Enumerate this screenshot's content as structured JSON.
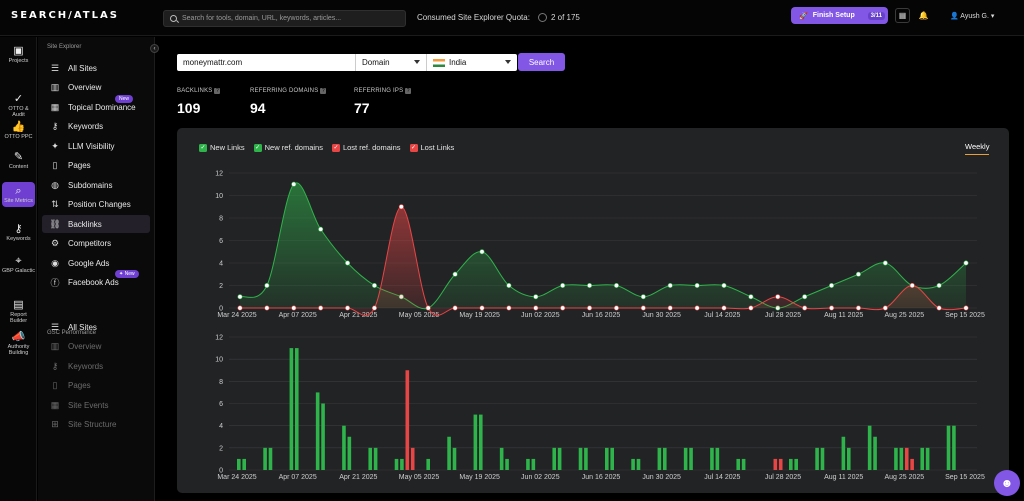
{
  "app": {
    "logo": "SEARCH/ATLAS"
  },
  "header": {
    "search_placeholder": "Search for tools, domain, URL, keywords, articles...",
    "quota_label": "Consumed Site Explorer Quota:",
    "quota_value": "2 of 175",
    "finish_label": "Finish Setup",
    "finish_badge": "3/11",
    "user_name": "Ayush G."
  },
  "rail": [
    {
      "label": "Projects",
      "icon": "briefcase-icon",
      "glyph": "▣"
    },
    {
      "label": "OTTO & Audit",
      "icon": "checklist-icon",
      "glyph": "✓"
    },
    {
      "label": "OTTO PPC",
      "icon": "thumbs-up-icon",
      "glyph": "👍"
    },
    {
      "label": "Content",
      "icon": "pen-icon",
      "glyph": "✎"
    },
    {
      "label": "Site Metrics",
      "icon": "magnifier-chart-icon",
      "glyph": "⌕"
    },
    {
      "label": "Keywords",
      "icon": "key-icon",
      "glyph": "⚷"
    },
    {
      "label": "GBP Galactic",
      "icon": "map-pin-icon",
      "glyph": "⌖"
    },
    {
      "label": "Report Builder",
      "icon": "report-icon",
      "glyph": "▤"
    },
    {
      "label": "Authority Building",
      "icon": "megaphone-icon",
      "glyph": "📣"
    }
  ],
  "sidebar": {
    "section1": "Site Explorer",
    "items1": [
      {
        "label": "All Sites",
        "icon": "list-icon",
        "glyph": "☰"
      },
      {
        "label": "Overview",
        "icon": "overview-icon",
        "glyph": "▥"
      },
      {
        "label": "Topical Dominance",
        "icon": "topical-icon",
        "glyph": "▦"
      },
      {
        "label": "Keywords",
        "icon": "key-icon",
        "glyph": "⚷"
      },
      {
        "label": "LLM Visibility",
        "icon": "sparkle-icon",
        "glyph": "✦"
      },
      {
        "label": "Pages",
        "icon": "page-icon",
        "glyph": "▯"
      },
      {
        "label": "Subdomains",
        "icon": "globe-icon",
        "glyph": "◍"
      },
      {
        "label": "Position Changes",
        "icon": "sort-icon",
        "glyph": "⇅"
      },
      {
        "label": "Backlinks",
        "icon": "link-icon",
        "glyph": "⛓"
      },
      {
        "label": "Competitors",
        "icon": "competitors-icon",
        "glyph": "⚙"
      },
      {
        "label": "Google Ads",
        "icon": "megaphone-icon",
        "glyph": "◉"
      },
      {
        "label": "Facebook Ads",
        "icon": "facebook-icon",
        "glyph": "ⓕ"
      }
    ],
    "new_badge_1": "New",
    "new_badge_2": "✦ New",
    "section2": "GSC Performance",
    "items2": [
      {
        "label": "All Sites",
        "icon": "list-icon",
        "glyph": "☰"
      },
      {
        "label": "Overview",
        "icon": "overview-icon",
        "glyph": "▥"
      },
      {
        "label": "Keywords",
        "icon": "key-icon",
        "glyph": "⚷"
      },
      {
        "label": "Pages",
        "icon": "page-icon",
        "glyph": "▯"
      },
      {
        "label": "Site Events",
        "icon": "calendar-icon",
        "glyph": "▦"
      },
      {
        "label": "Site Structure",
        "icon": "structure-icon",
        "glyph": "⊞"
      }
    ]
  },
  "controls": {
    "domain_value": "moneymattr.com",
    "scope_value": "Domain",
    "country_value": "India",
    "search_label": "Search"
  },
  "stats": [
    {
      "label": "BACKLINKS",
      "value": "109"
    },
    {
      "label": "REFERRING DOMAINS",
      "value": "94"
    },
    {
      "label": "REFERRING IPS",
      "value": "77"
    }
  ],
  "legend": [
    {
      "label": "New Links",
      "color": "#2fb34b"
    },
    {
      "label": "New ref. domains",
      "color": "#2fb34b"
    },
    {
      "label": "Lost ref. domains",
      "color": "#e84545"
    },
    {
      "label": "Lost Links",
      "color": "#e84545"
    }
  ],
  "period_label": "Weekly",
  "colors": {
    "green": "#2fb34b",
    "red": "#e84545",
    "accent": "#8257e5"
  },
  "chart_data": [
    {
      "type": "area",
      "x_ticks": [
        "Mar 24 2025",
        "Apr 07 2025",
        "Apr 21 2025",
        "May 05 2025",
        "May 19 2025",
        "Jun 02 2025",
        "Jun 16 2025",
        "Jun 30 2025",
        "Jul 14 2025",
        "Jul 28 2025",
        "Aug 11 2025",
        "Aug 25 2025",
        "Sep 15 2025"
      ],
      "ylim": [
        0,
        12
      ],
      "y_ticks": [
        0,
        2,
        4,
        6,
        8,
        10,
        12
      ],
      "series": [
        {
          "name": "New ref. domains",
          "color": "#2fb34b",
          "values": [
            1,
            2,
            11,
            7,
            4,
            2,
            1,
            0,
            3,
            5,
            2,
            1,
            2,
            2,
            2,
            1,
            2,
            2,
            2,
            1,
            0,
            1,
            2,
            3,
            4,
            2,
            2,
            4
          ]
        },
        {
          "name": "Lost ref. domains",
          "color": "#e84545",
          "values": [
            0,
            0,
            0,
            0,
            0,
            0,
            9,
            0,
            0,
            0,
            0,
            0,
            0,
            0,
            0,
            0,
            0,
            0,
            0,
            0,
            1,
            0,
            0,
            0,
            0,
            2,
            0,
            0
          ]
        }
      ]
    },
    {
      "type": "bar",
      "x_ticks": [
        "Mar 24 2025",
        "Apr 07 2025",
        "Apr 21 2025",
        "May 05 2025",
        "May 19 2025",
        "Jun 02 2025",
        "Jun 16 2025",
        "Jun 30 2025",
        "Jul 14 2025",
        "Jul 28 2025",
        "Aug 11 2025",
        "Aug 25 2025",
        "Sep 15 2025"
      ],
      "ylim": [
        0,
        12
      ],
      "y_ticks": [
        0,
        2,
        4,
        6,
        8,
        10,
        12
      ],
      "series": [
        {
          "name": "New Links",
          "color": "#2fb34b",
          "values": [
            1,
            2,
            11,
            7,
            4,
            2,
            1,
            0,
            3,
            5,
            2,
            1,
            2,
            2,
            2,
            1,
            2,
            2,
            2,
            1,
            0,
            1,
            2,
            3,
            4,
            2,
            2,
            4
          ]
        },
        {
          "name": "New ref. domains",
          "color": "#2fb34b",
          "values": [
            1,
            2,
            11,
            6,
            3,
            2,
            1,
            1,
            2,
            5,
            1,
            1,
            2,
            2,
            2,
            1,
            2,
            2,
            2,
            1,
            0,
            1,
            2,
            2,
            3,
            2,
            2,
            4
          ]
        },
        {
          "name": "Lost ref. domains",
          "color": "#e84545",
          "values": [
            0,
            0,
            0,
            0,
            0,
            0,
            9,
            0,
            0,
            0,
            0,
            0,
            0,
            0,
            0,
            0,
            0,
            0,
            0,
            0,
            1,
            0,
            0,
            0,
            0,
            2,
            0,
            0
          ]
        },
        {
          "name": "Lost Links",
          "color": "#e84545",
          "values": [
            0,
            0,
            0,
            0,
            0,
            0,
            2,
            0,
            0,
            0,
            0,
            0,
            0,
            0,
            0,
            0,
            0,
            0,
            0,
            0,
            1,
            0,
            0,
            0,
            0,
            1,
            0,
            0
          ]
        }
      ]
    }
  ]
}
